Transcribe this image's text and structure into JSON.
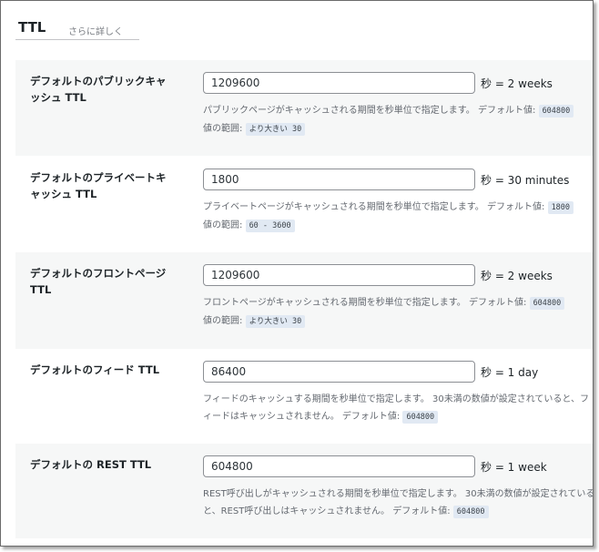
{
  "tabs": {
    "active": "TTL",
    "more": "さらに詳しく"
  },
  "settings": [
    {
      "label": "デフォルトのパブリックキャッシュ TTL",
      "value": "1209600",
      "suffix": "秒 = 2 weeks",
      "description": "パブリックページがキャッシュされる期間を秒単位で指定します。",
      "default_label": "デフォルト値:",
      "default": "604800",
      "range_label": "値の範囲:",
      "range": "より大きい 30"
    },
    {
      "label": "デフォルトのプライベートキャッシュ TTL",
      "value": "1800",
      "suffix": "秒 = 30 minutes",
      "description": "プライベートページがキャッシュされる期間を秒単位で指定します。",
      "default_label": "デフォルト値:",
      "default": "1800",
      "range_label": "値の範囲:",
      "range": "60 - 3600"
    },
    {
      "label": "デフォルトのフロントページ TTL",
      "value": "1209600",
      "suffix": "秒 = 2 weeks",
      "description": "フロントページがキャッシュされる期間を秒単位で指定します。",
      "default_label": "デフォルト値:",
      "default": "604800",
      "range_label": "値の範囲:",
      "range": "より大きい 30"
    },
    {
      "label": "デフォルトのフィード TTL",
      "value": "86400",
      "suffix": "秒 = 1 day",
      "description": "フィードのキャッシュする期間を秒単位で指定します。 30未満の数値が設定されていると、フィードはキャッシュされません。",
      "default_label": "デフォルト値:",
      "default": "604800"
    },
    {
      "label": "デフォルトの REST TTL",
      "value": "604800",
      "suffix": "秒 = 1 week",
      "description": "REST呼び出しがキャッシュされる期間を秒単位で指定します。 30未満の数値が設定されていると、REST呼び出しはキャッシュされません。",
      "default_label": "デフォルト値:",
      "default": "604800"
    }
  ]
}
